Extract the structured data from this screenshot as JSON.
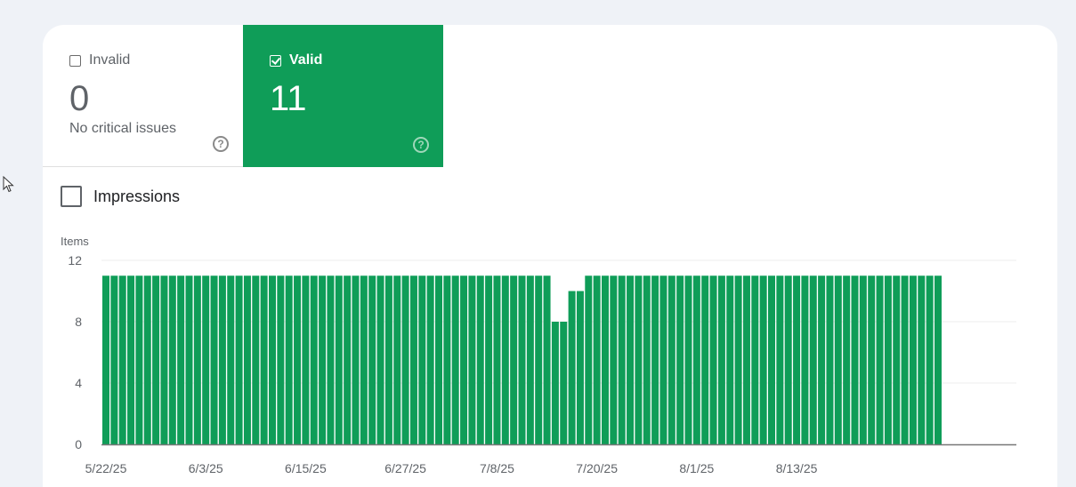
{
  "tiles": {
    "invalid": {
      "label": "Invalid",
      "count": "0",
      "subtitle": "No critical issues",
      "selected": false
    },
    "valid": {
      "label": "Valid",
      "count": "11",
      "selected": true
    }
  },
  "metrics": {
    "impressions_label": "Impressions",
    "impressions_checked": false
  },
  "colors": {
    "accent": "#0f9d58",
    "background": "#eff2f7",
    "card": "#ffffff"
  },
  "icons": {
    "help": "help-circle-icon",
    "cursor": "mouse-pointer-icon"
  },
  "chart_data": {
    "type": "bar",
    "ylabel": "Items",
    "ylim": [
      0,
      12
    ],
    "yticks": [
      0,
      4,
      8,
      12
    ],
    "x_tick_labels": [
      "5/22/25",
      "6/3/25",
      "6/15/25",
      "6/27/25",
      "7/8/25",
      "7/20/25",
      "8/1/25",
      "8/13/25"
    ],
    "x_tick_index": [
      0,
      12,
      24,
      36,
      47,
      59,
      71,
      83
    ],
    "start_date": "2025-05-22",
    "values": [
      11,
      11,
      11,
      11,
      11,
      11,
      11,
      11,
      11,
      11,
      11,
      11,
      11,
      11,
      11,
      11,
      11,
      11,
      11,
      11,
      11,
      11,
      11,
      11,
      11,
      11,
      11,
      11,
      11,
      11,
      11,
      11,
      11,
      11,
      11,
      11,
      11,
      11,
      11,
      11,
      11,
      11,
      11,
      11,
      11,
      11,
      11,
      11,
      11,
      11,
      11,
      11,
      11,
      11,
      8,
      8,
      10,
      10,
      11,
      11,
      11,
      11,
      11,
      11,
      11,
      11,
      11,
      11,
      11,
      11,
      11,
      11,
      11,
      11,
      11,
      11,
      11,
      11,
      11,
      11,
      11,
      11,
      11,
      11,
      11,
      11,
      11,
      11,
      11,
      11,
      11,
      11,
      11,
      11,
      11,
      11,
      11,
      11,
      11,
      11,
      11
    ],
    "series_color": "#0f9d58",
    "grid": true
  }
}
